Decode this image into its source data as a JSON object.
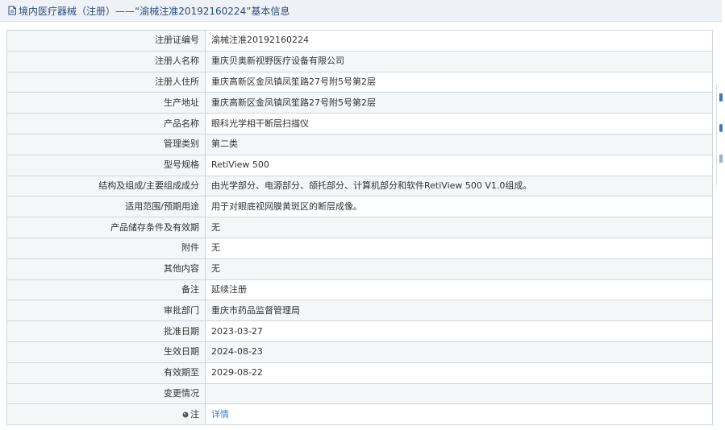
{
  "header": {
    "title": "境内医疗器械（注册）——“渝械注准20192160224”基本信息",
    "icon": "document-icon"
  },
  "rows": [
    {
      "label": "注册证编号",
      "value": "渝械注准20192160224"
    },
    {
      "label": "注册人名称",
      "value": "重庆贝奥新视野医疗设备有限公司"
    },
    {
      "label": "注册人住所",
      "value": "重庆高新区金凤镇凤笙路27号附5号第2层"
    },
    {
      "label": "生产地址",
      "value": "重庆高新区金凤镇凤笙路27号附5号第2层"
    },
    {
      "label": "产品名称",
      "value": "眼科光学相干断层扫描仪"
    },
    {
      "label": "管理类别",
      "value": "第二类"
    },
    {
      "label": "型号规格",
      "value": "RetiView 500"
    },
    {
      "label": "结构及组成/主要组成成分",
      "value": "由光学部分、电源部分、颌托部分、计算机部分和软件RetiView 500 V1.0组成。"
    },
    {
      "label": "适用范围/预期用途",
      "value": "用于对眼底视网膜黄斑区的断层成像。"
    },
    {
      "label": "产品储存条件及有效期",
      "value": "无"
    },
    {
      "label": "附件",
      "value": "无"
    },
    {
      "label": "其他内容",
      "value": "无"
    },
    {
      "label": "备注",
      "value": "延续注册"
    },
    {
      "label": "审批部门",
      "value": "重庆市药品监督管理局"
    },
    {
      "label": "批准日期",
      "value": "2023-03-27"
    },
    {
      "label": "生效日期",
      "value": "2024-08-23"
    },
    {
      "label": "有效期至",
      "value": "2029-08-22"
    },
    {
      "label": "变更情况",
      "value": ""
    }
  ],
  "note": {
    "label": "注",
    "link": "详情",
    "icon": "note-dot-icon"
  },
  "colors": {
    "header_bg": "#eef1f5",
    "title": "#2b4f7c",
    "label_bg": "#f5f6f7",
    "border": "#cfd6de",
    "link": "#3a7bc8"
  }
}
